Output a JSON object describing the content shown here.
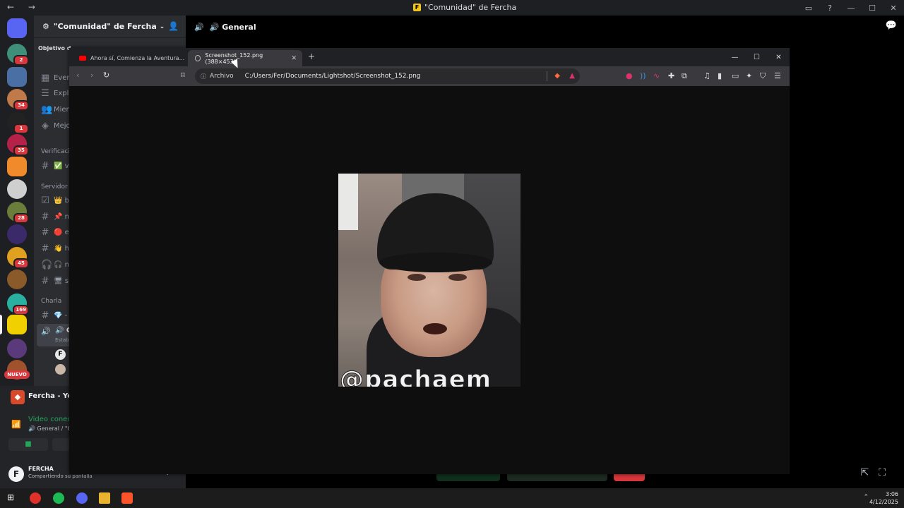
{
  "window": {
    "title": "\"Comunidad\" de Fercha",
    "nav_arrows": "← →",
    "controls": [
      "—",
      "☐",
      "✕"
    ]
  },
  "server": {
    "name": "\"Comunidad\" de Fercha",
    "objective_label": "Objetivo d"
  },
  "rail": {
    "badges": [
      "2",
      "34",
      "1",
      "35",
      "28",
      "45",
      "169"
    ],
    "new_label": "NUEVO"
  },
  "sidebar": {
    "items": [
      {
        "label": "Ever"
      },
      {
        "label": "Expl"
      },
      {
        "label": "Mien"
      },
      {
        "label": "Mejo"
      }
    ],
    "categories": {
      "verification": "Verificaci",
      "server": "Servidor",
      "chat": "Charla"
    },
    "channels": [
      {
        "label": "✅ v"
      },
      {
        "label": "👑 b"
      },
      {
        "label": "📌 n"
      },
      {
        "label": "🔴 e"
      },
      {
        "label": "👋 h"
      },
      {
        "label": "🎧 n"
      },
      {
        "label": "🖥 s"
      },
      {
        "label": "💎 -"
      }
    ],
    "voice_channel": {
      "label": "🔊 G",
      "sub": "Estab"
    }
  },
  "voice_panel": {
    "title": "Fercha - You",
    "status": "Video conec",
    "sub": "🔊 General / \"Co"
  },
  "user": {
    "initial": "F",
    "name": "FERCHA",
    "status": "Compartiendo su pantalla"
  },
  "main": {
    "channel_name": "🔊 General"
  },
  "browser": {
    "tabs": [
      {
        "label": "Ahora sí, Comienza la Aventura..."
      },
      {
        "label": "Screenshot_152.png (388×453)"
      }
    ],
    "address": {
      "scheme": "Archivo",
      "url": "C:/Users/Fer/Documents/Lightshot/Screenshot_152.png"
    },
    "image_watermark": "@pachaem"
  },
  "taskbar": {
    "time": "3:06",
    "date": "4/12/2025"
  },
  "colors": {
    "discord_bg": "#1e1f22",
    "sidebar_bg": "#2b2d31",
    "browser_toolbar": "#3a3a3e",
    "green": "#23a55a",
    "red": "#da373c"
  }
}
